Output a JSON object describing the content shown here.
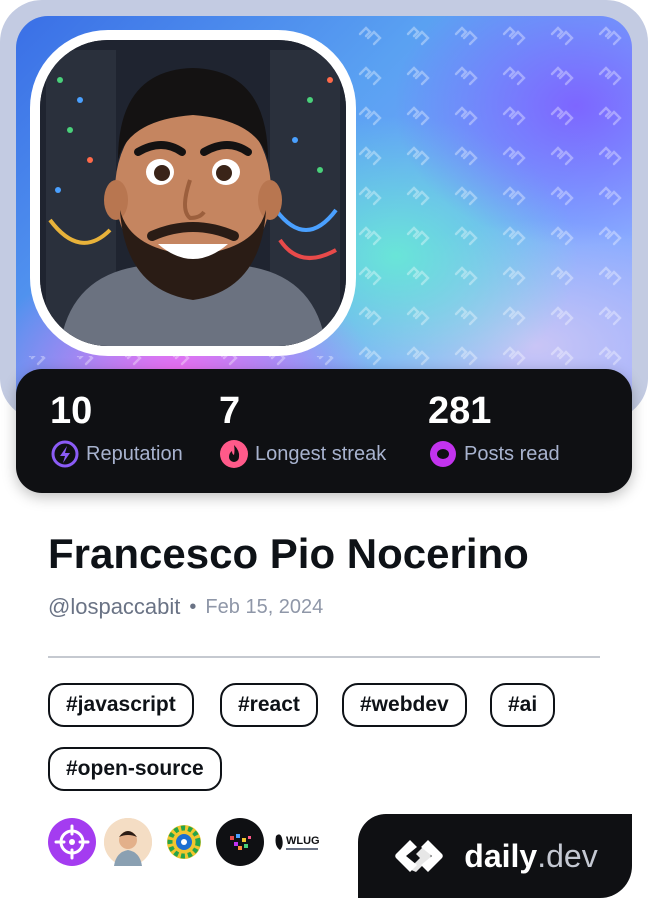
{
  "stats": [
    {
      "value": "10",
      "label": "Reputation",
      "icon": "reputation-bolt-icon",
      "color": "#8b5cf6"
    },
    {
      "value": "7",
      "label": "Longest streak",
      "icon": "streak-flame-icon",
      "color": "#ff5a8a"
    },
    {
      "value": "281",
      "label": "Posts read",
      "icon": "posts-read-eye-icon",
      "color": "#c233ee"
    }
  ],
  "profile": {
    "name": "Francesco Pio Nocerino",
    "handle": "@lospaccabit",
    "separator": "•",
    "joined": "Feb 15, 2024"
  },
  "tags": [
    "#javascript",
    "#react",
    "#webdev",
    "#ai",
    "#open-source"
  ],
  "badges": [
    {
      "icon": "purple-target-badge-icon",
      "color": "#a43cf0"
    },
    {
      "icon": "avatar-squad-badge-icon",
      "color": "#e9b27a"
    },
    {
      "icon": "gear-squad-badge-icon",
      "color": "#26a44a"
    },
    {
      "icon": "black-pixel-badge-icon",
      "color": "#0f1013"
    },
    {
      "icon": "wlug-badge-icon",
      "color": "#ffffff",
      "text": "WLUG"
    }
  ],
  "brand": {
    "name": "daily",
    "tld": ".dev"
  }
}
